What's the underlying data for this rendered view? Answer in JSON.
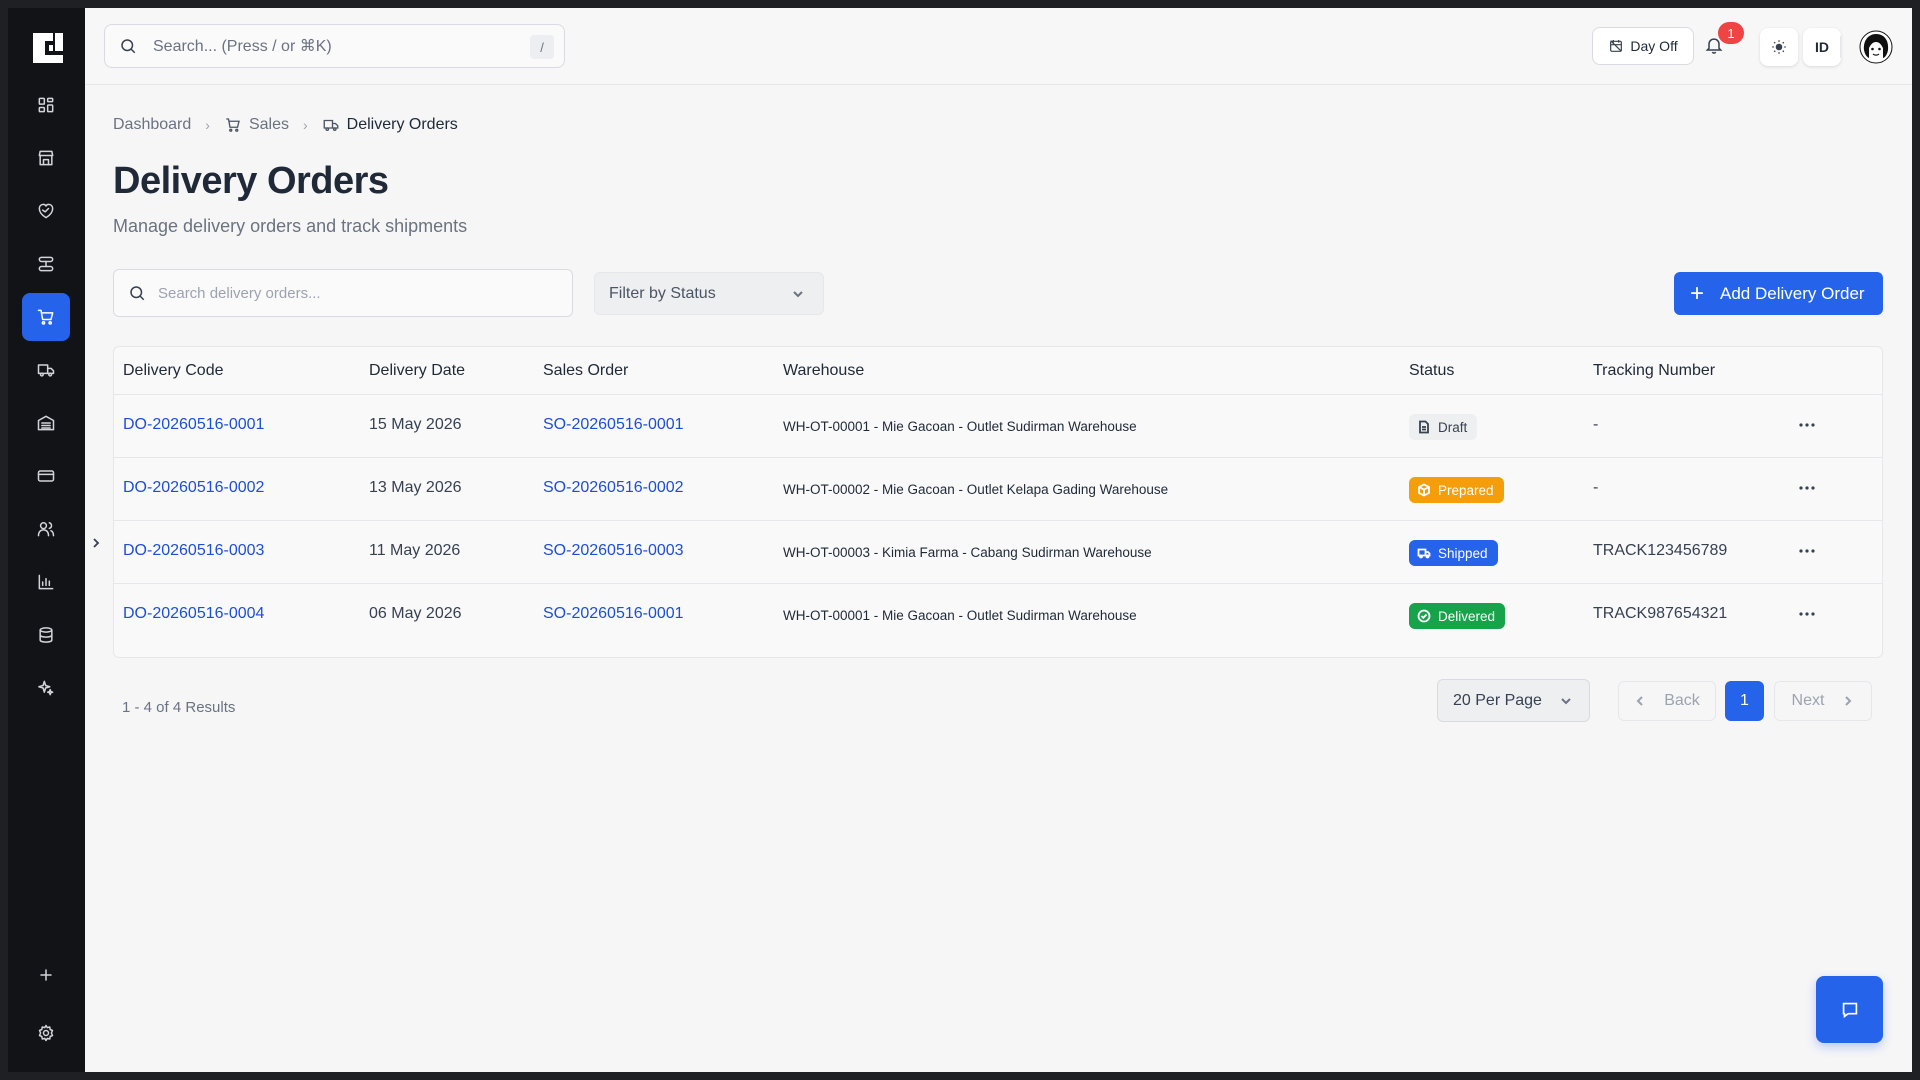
{
  "topbar": {
    "search_placeholder": "Search... (Press / or ⌘K)",
    "search_shortcut": "/",
    "day_off_label": "Day Off",
    "notification_count": "1",
    "language_label": "ID"
  },
  "breadcrumb": {
    "items": [
      "Dashboard",
      "Sales",
      "Delivery Orders"
    ]
  },
  "page": {
    "title": "Delivery Orders",
    "subtitle": "Manage delivery orders and track shipments"
  },
  "toolbar": {
    "search_placeholder": "Search delivery orders...",
    "filter_label": "Filter by Status",
    "add_button": "Add Delivery Order",
    "add_icon": "+"
  },
  "table": {
    "columns": [
      "Delivery Code",
      "Delivery Date",
      "Sales Order",
      "Warehouse",
      "Status",
      "Tracking Number"
    ],
    "rows": [
      {
        "code": "DO-20260516-0001",
        "date": "15 May 2026",
        "sales_order": "SO-20260516-0001",
        "warehouse": "WH-OT-00001 - Mie Gacoan - Outlet Sudirman Warehouse",
        "status": "Draft",
        "tracking": "-"
      },
      {
        "code": "DO-20260516-0002",
        "date": "13 May 2026",
        "sales_order": "SO-20260516-0002",
        "warehouse": "WH-OT-00002 - Mie Gacoan - Outlet Kelapa Gading Warehouse",
        "status": "Prepared",
        "tracking": "-"
      },
      {
        "code": "DO-20260516-0003",
        "date": "11 May 2026",
        "sales_order": "SO-20260516-0003",
        "warehouse": "WH-OT-00003 - Kimia Farma - Cabang Sudirman Warehouse",
        "status": "Shipped",
        "tracking": "TRACK123456789"
      },
      {
        "code": "DO-20260516-0004",
        "date": "06 May 2026",
        "sales_order": "SO-20260516-0001",
        "warehouse": "WH-OT-00001 - Mie Gacoan - Outlet Sudirman Warehouse",
        "status": "Delivered",
        "tracking": "TRACK987654321"
      }
    ]
  },
  "pagination": {
    "results_text": "1 - 4 of 4 Results",
    "per_page": "20 Per Page",
    "back_label": "Back",
    "current_page": "1",
    "next_label": "Next"
  },
  "colors": {
    "accent": "#2563eb",
    "prepared": "#f59e0b",
    "delivered": "#16a34a",
    "sidebar": "#121316"
  },
  "sidebar": {
    "icons": [
      "dashboard-icon",
      "store-icon",
      "handshake-icon",
      "workflow-icon",
      "cart-icon",
      "truck-icon",
      "warehouse-icon",
      "card-icon",
      "users-icon",
      "chart-icon",
      "database-icon",
      "sparkle-icon",
      "plus-icon",
      "gear-icon"
    ],
    "active": "cart-icon"
  }
}
